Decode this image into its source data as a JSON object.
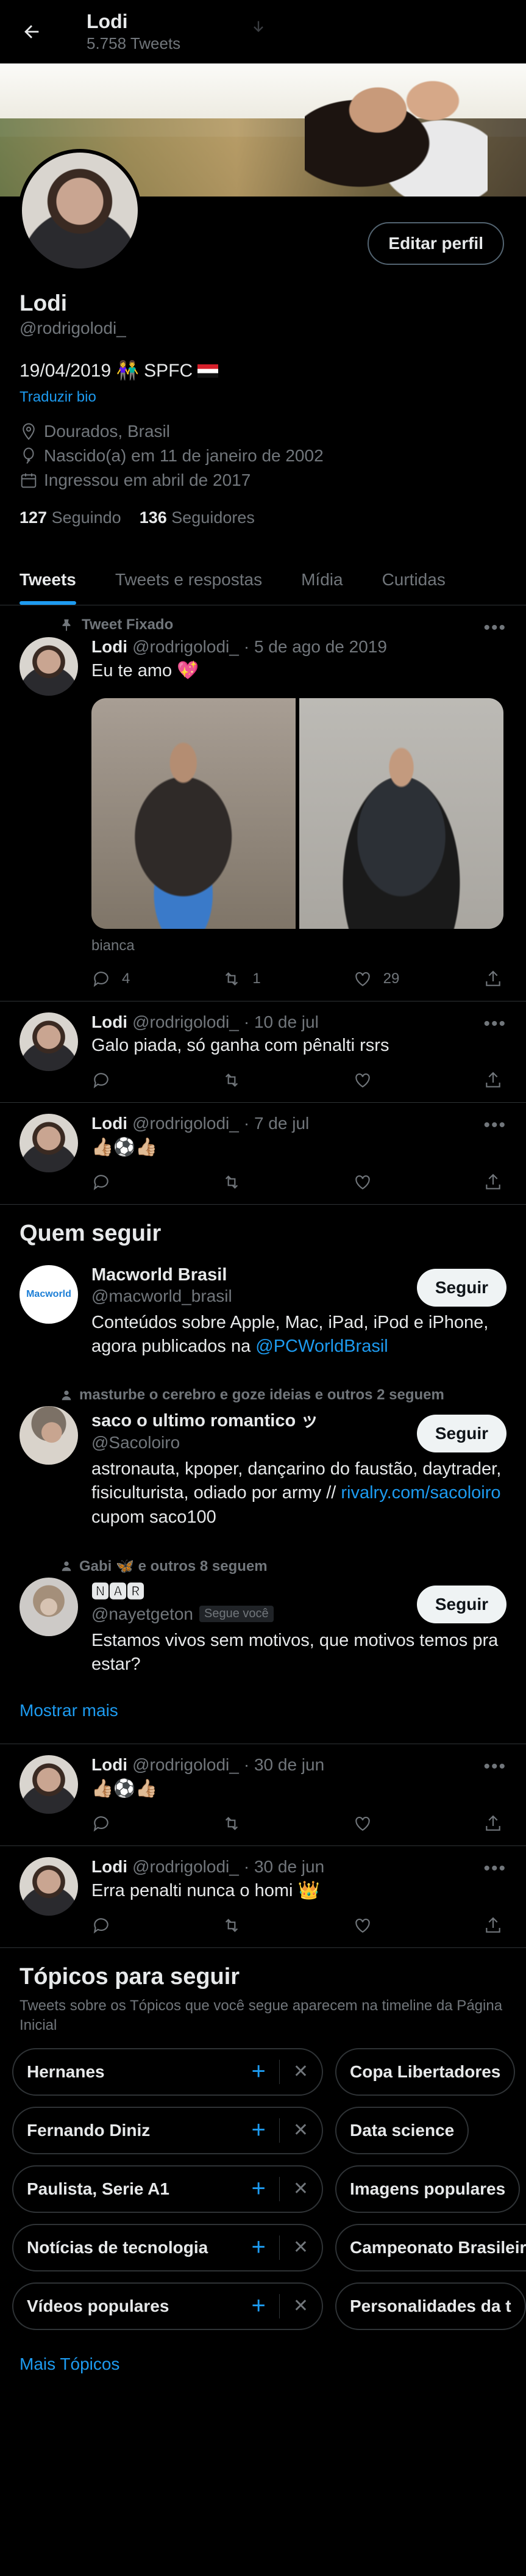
{
  "header": {
    "name": "Lodi",
    "tweet_count": "5.758 Tweets"
  },
  "profile": {
    "name": "Lodi",
    "handle": "@rodrigolodi_",
    "edit_label": "Editar perfil",
    "bio": "19/04/2019 👫 SPFC",
    "translate": "Traduzir bio",
    "location": "Dourados, Brasil",
    "birth": "Nascido(a) em 11 de janeiro de 2002",
    "joined": "Ingressou em abril de 2017",
    "following_count": "127",
    "following_label": "Seguindo",
    "followers_count": "136",
    "followers_label": "Seguidores"
  },
  "tabs": [
    "Tweets",
    "Tweets e respostas",
    "Mídia",
    "Curtidas"
  ],
  "pinned_label": "Tweet Fixado",
  "tweets": [
    {
      "name": "Lodi",
      "handle": "@rodrigolodi_",
      "date": "· 5 de ago de 2019",
      "text": "Eu te amo 💖",
      "tag": "bianca",
      "replies": "4",
      "retweets": "1",
      "likes": "29"
    },
    {
      "name": "Lodi",
      "handle": "@rodrigolodi_",
      "date": "· 10 de jul",
      "text": "Galo piada, só ganha com pênalti rsrs"
    },
    {
      "name": "Lodi",
      "handle": "@rodrigolodi_",
      "date": "· 7 de jul",
      "text": "👍🏼⚽👍🏼"
    },
    {
      "name": "Lodi",
      "handle": "@rodrigolodi_",
      "date": "· 30 de jun",
      "text": "👍🏼⚽👍🏼"
    },
    {
      "name": "Lodi",
      "handle": "@rodrigolodi_",
      "date": "· 30 de jun",
      "text": "Erra penalti nunca o homi 👑"
    }
  ],
  "who_to_follow": {
    "title": "Quem seguir",
    "follow_label": "Seguir",
    "show_more": "Mostrar mais",
    "accounts": [
      {
        "social": "",
        "name": "Macworld Brasil",
        "handle": "@macworld_brasil",
        "badge": "",
        "desc": "Conteúdos sobre Apple, Mac, iPad, iPod e iPhone, agora publicados na ",
        "link": "@PCWorldBrasil",
        "desc2": "",
        "logo": "Macworld"
      },
      {
        "social": "masturbe o cerebro e goze ideias e outros 2 seguem",
        "name": "saco o ultimo romantico ッ",
        "handle": "@Sacoloiro",
        "badge": "",
        "desc": "astronauta, kpoper, dançarino do faustão, daytrader, fisiculturista, odiado por army // ",
        "link": "rivalry.com/sacoloiro",
        "desc2": " cupom saco100"
      },
      {
        "social": "Gabi 🦋 e outros 8 seguem",
        "name": "🅽🅰🆁",
        "handle": "@nayetgeton",
        "badge": "Segue você",
        "desc": "Estamos vivos sem motivos, que motivos temos pra estar?",
        "link": "",
        "desc2": ""
      }
    ]
  },
  "topics": {
    "title": "Tópicos para seguir",
    "subtitle": "Tweets sobre os Tópicos que você segue aparecem na timeline da Página Inicial",
    "rows": [
      [
        "Hernanes",
        "Copa Libertadores"
      ],
      [
        "Fernando Diniz",
        "Data science"
      ],
      [
        "Paulista, Serie A1",
        "Imagens populares"
      ],
      [
        "Notícias de tecnologia",
        "Campeonato Brasileiro"
      ],
      [
        "Vídeos populares",
        "Personalidades da t"
      ]
    ],
    "more": "Mais Tópicos"
  }
}
